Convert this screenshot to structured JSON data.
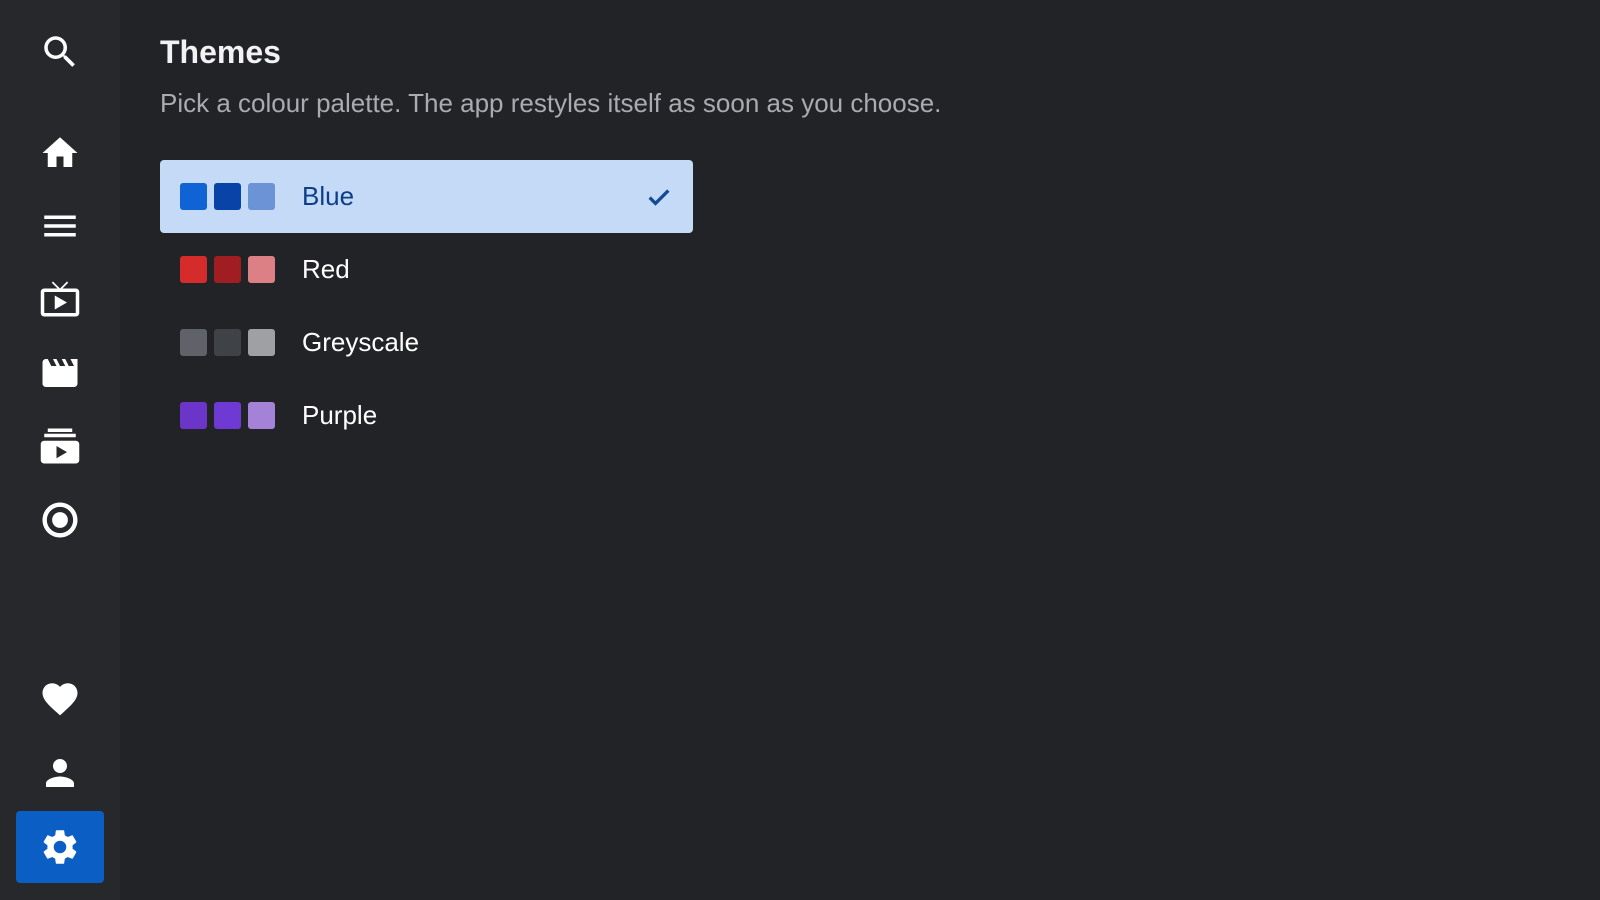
{
  "page": {
    "title": "Themes",
    "subtitle": "Pick a colour palette. The app restyles itself as soon as you choose."
  },
  "sidebar": {
    "items": [
      {
        "name": "search",
        "icon": "search-icon",
        "active": false
      },
      {
        "name": "home",
        "icon": "home-icon",
        "active": false
      },
      {
        "name": "menu",
        "icon": "menu-icon",
        "active": false
      },
      {
        "name": "live-tv",
        "icon": "tv-icon",
        "active": false
      },
      {
        "name": "movies",
        "icon": "clapperboard-icon",
        "active": false
      },
      {
        "name": "series",
        "icon": "video-library-icon",
        "active": false
      },
      {
        "name": "radio",
        "icon": "circle-target-icon",
        "active": false
      },
      {
        "name": "favourites",
        "icon": "heart-icon",
        "active": false
      },
      {
        "name": "profile",
        "icon": "person-icon",
        "active": false
      },
      {
        "name": "settings",
        "icon": "gear-icon",
        "active": true
      }
    ],
    "active_color": "#0b5ec4"
  },
  "themes": [
    {
      "label": "Blue",
      "selected": true,
      "swatches": [
        "#0f63d4",
        "#0844a8",
        "#6c93d6"
      ]
    },
    {
      "label": "Red",
      "selected": false,
      "swatches": [
        "#d62b2b",
        "#a01e22",
        "#dc8085"
      ]
    },
    {
      "label": "Greyscale",
      "selected": false,
      "swatches": [
        "#5f6268",
        "#3f4247",
        "#9ea0a4"
      ]
    },
    {
      "label": "Purple",
      "selected": false,
      "swatches": [
        "#6b35c9",
        "#6f3ad4",
        "#a382d8"
      ]
    }
  ],
  "colors": {
    "background": "#222327",
    "sidebar": "#27282c",
    "selected_row": "#c4daf6",
    "selected_text": "#0c3f8a"
  }
}
